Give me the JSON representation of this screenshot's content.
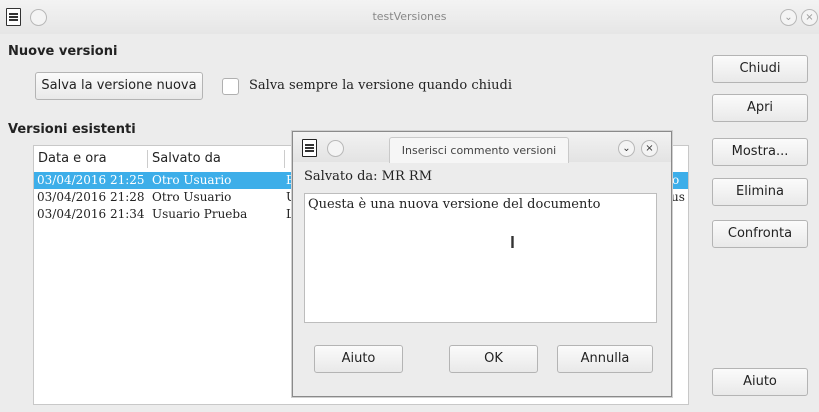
{
  "window": {
    "title": "testVersiones"
  },
  "sections": {
    "new_versions": "Nuove versioni",
    "existing_versions": "Versioni esistenti"
  },
  "new": {
    "save_button": "Salva la versione nuova",
    "always_save_label": "Salva sempre la versione quando chiudi",
    "always_save_checked": false
  },
  "side_buttons": {
    "close": "Chiudi",
    "open": "Apri",
    "show": "Mostra...",
    "delete": "Elimina",
    "compare": "Confronta",
    "help": "Aiuto"
  },
  "table": {
    "headers": [
      "Data e ora",
      "Salvato da"
    ],
    "rows": [
      {
        "date": "03/04/2016 21:25",
        "author": "Otro Usuario",
        "comment_fragment": "E",
        "right_fragment": "o",
        "selected": true
      },
      {
        "date": "03/04/2016 21:28",
        "author": "Otro Usuario",
        "comment_fragment": "U",
        "right_fragment": "o us",
        "selected": false
      },
      {
        "date": "03/04/2016 21:34",
        "author": "Usuario Prueba",
        "comment_fragment": "L",
        "right_fragment": "",
        "selected": false
      }
    ]
  },
  "dialog": {
    "title": "Inserisci commento versioni",
    "saved_by": "Salvato da: MR RM",
    "comment": "Questa è una nuova versione del documento",
    "buttons": {
      "help": "Aiuto",
      "ok": "OK",
      "cancel": "Annulla"
    }
  },
  "icons": {
    "window_minimize": "chevron-down-icon",
    "window_close": "close-icon"
  },
  "colors": {
    "selection": "#3daee9",
    "background": "#ececec"
  }
}
